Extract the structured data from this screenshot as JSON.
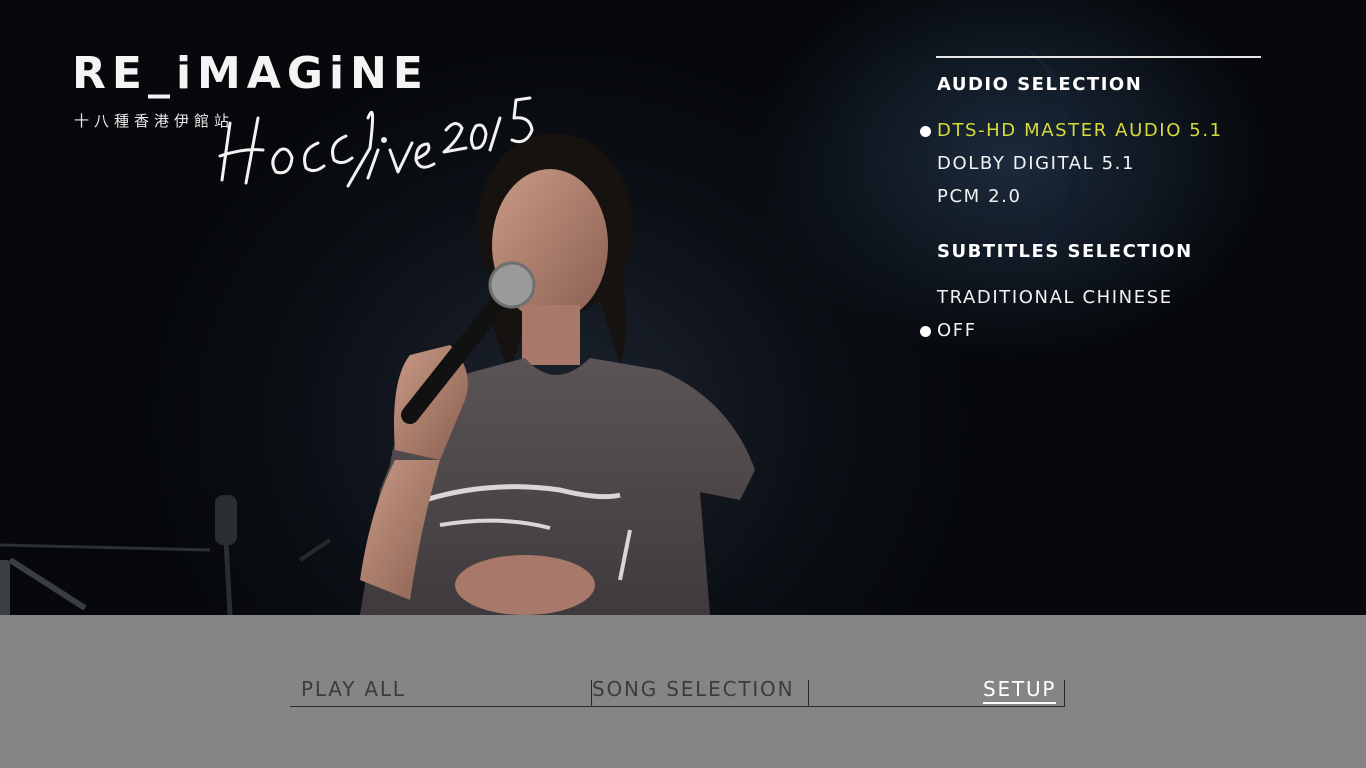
{
  "logo": {
    "title": "RE_iMAGiNE",
    "subtitle": "十八種香港伊館站",
    "script": "Hocc live 2015"
  },
  "setup_panel": {
    "audio": {
      "heading": "AUDIO SELECTION",
      "options": [
        {
          "label": "DTS-HD MASTER AUDIO 5.1",
          "selected": true,
          "highlighted": true
        },
        {
          "label": "DOLBY DIGITAL 5.1",
          "selected": false,
          "highlighted": false
        },
        {
          "label": "PCM 2.0",
          "selected": false,
          "highlighted": false
        }
      ]
    },
    "subtitles": {
      "heading": "SUBTITLES SELECTION",
      "options": [
        {
          "label": "TRADITIONAL CHINESE",
          "selected": false
        },
        {
          "label": "OFF",
          "selected": true
        }
      ]
    }
  },
  "menu": {
    "items": [
      {
        "label": "PLAY ALL",
        "selected": false
      },
      {
        "label": "SONG SELECTION",
        "selected": false
      },
      {
        "label": "SETUP",
        "selected": true
      }
    ]
  },
  "colors": {
    "highlight": "#d7db3a",
    "menu_bar": "#858585",
    "menu_text": "#3c3c3c",
    "menu_selected": "#ffffff"
  }
}
